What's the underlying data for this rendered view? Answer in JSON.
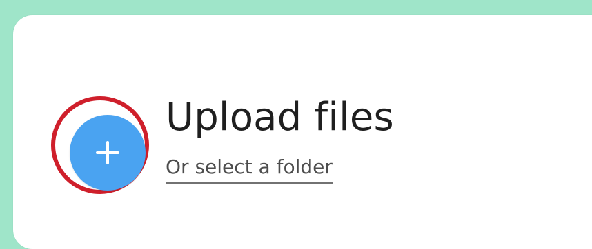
{
  "upload_panel": {
    "title": "Upload files",
    "secondary_action_label": "Or select a folder",
    "add_button": {
      "icon": "plus-icon",
      "color": "#4aa3f1"
    },
    "highlight_color": "#cf1f2b"
  }
}
